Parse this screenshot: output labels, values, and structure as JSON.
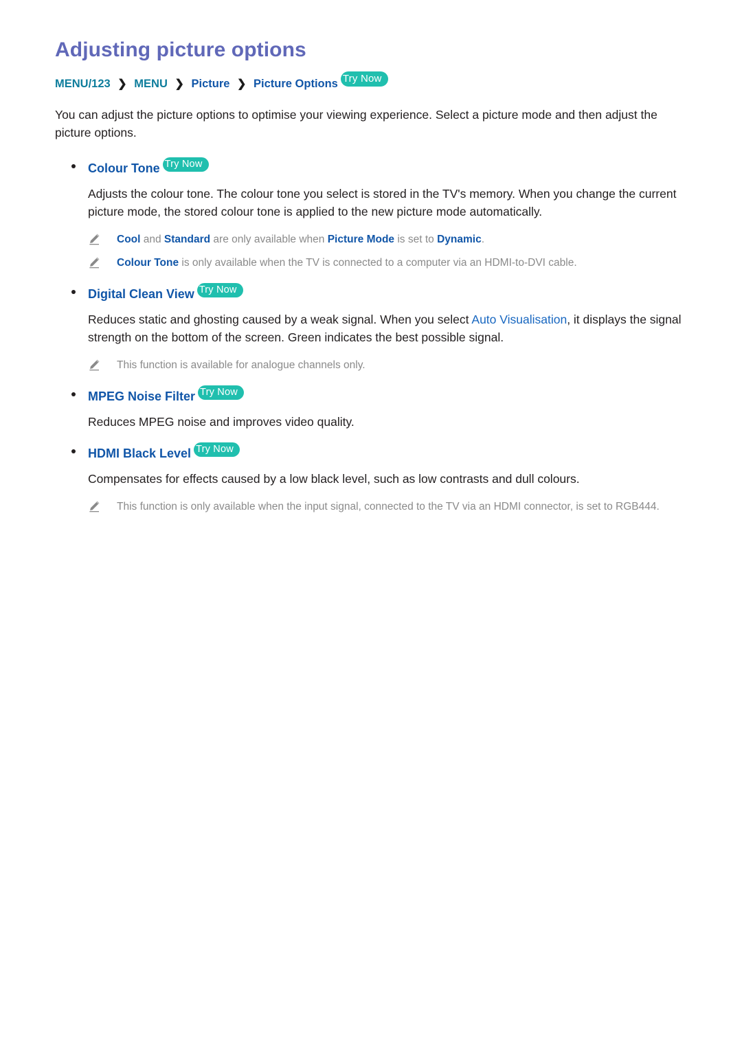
{
  "page": {
    "title": "Adjusting picture options",
    "title_color": "#6068b8"
  },
  "breadcrumb": {
    "name": "menu-path",
    "items": [
      {
        "label": "MENU/123",
        "style": "teal"
      },
      {
        "label": "MENU",
        "style": "teal"
      },
      {
        "label": "Picture",
        "style": "blue"
      },
      {
        "label": "Picture Options",
        "style": "blue"
      }
    ],
    "separator": "›",
    "try_now": "Try Now"
  },
  "intro": "You can adjust the picture options to optimise your viewing experience. Select a picture mode and then adjust the picture options.",
  "badge": {
    "try_now_label": "Try Now",
    "color": "#20bfae",
    "text_color": "#ffffff"
  },
  "sections": [
    {
      "heading": "Colour Tone",
      "has_try_now": true,
      "body_parts": [
        {
          "text": "Adjusts the colour tone. The colour tone you select is stored in the TV's memory. When you change the current picture mode, the stored colour tone is applied to the new picture mode automatically.",
          "style": "normal"
        }
      ],
      "notes": [
        {
          "parts": [
            {
              "text": "Cool",
              "style": "blue-bold"
            },
            {
              "text": " and ",
              "style": "grey"
            },
            {
              "text": "Standard",
              "style": "blue-bold"
            },
            {
              "text": " are only available when ",
              "style": "grey"
            },
            {
              "text": "Picture Mode",
              "style": "blue-bold"
            },
            {
              "text": " is set to ",
              "style": "grey"
            },
            {
              "text": "Dynamic",
              "style": "blue-bold"
            },
            {
              "text": ".",
              "style": "grey"
            }
          ]
        },
        {
          "parts": [
            {
              "text": "Colour Tone",
              "style": "blue-bold"
            },
            {
              "text": " is only available when the TV is connected to a computer via an HDMI-to-DVI cable.",
              "style": "grey"
            }
          ]
        }
      ]
    },
    {
      "heading": "Digital Clean View",
      "has_try_now": true,
      "body_parts": [
        {
          "text": "Reduces static and ghosting caused by a weak signal. When you select ",
          "style": "normal"
        },
        {
          "text": "Auto Visualisation",
          "style": "blue"
        },
        {
          "text": ", it displays the signal strength on the bottom of the screen. Green indicates the best possible signal.",
          "style": "normal"
        }
      ],
      "notes": [
        {
          "parts": [
            {
              "text": "This function is available for analogue channels only.",
              "style": "grey"
            }
          ]
        }
      ]
    },
    {
      "heading": "MPEG Noise Filter",
      "has_try_now": true,
      "body_parts": [
        {
          "text": "Reduces MPEG noise and improves video quality.",
          "style": "normal"
        }
      ],
      "notes": []
    },
    {
      "heading": "HDMI Black Level",
      "has_try_now": true,
      "body_parts": [
        {
          "text": "Compensates for effects caused by a low black level, such as low contrasts and dull colours.",
          "style": "normal"
        }
      ],
      "notes": [
        {
          "parts": [
            {
              "text": "This function is only available when the input signal, connected to the TV via an HDMI connector, is set to RGB444.",
              "style": "grey"
            }
          ]
        }
      ]
    }
  ],
  "icons": {
    "note": "pencil-icon",
    "bullet": "bullet-dot-icon",
    "separator": "chevron-right-icon"
  }
}
